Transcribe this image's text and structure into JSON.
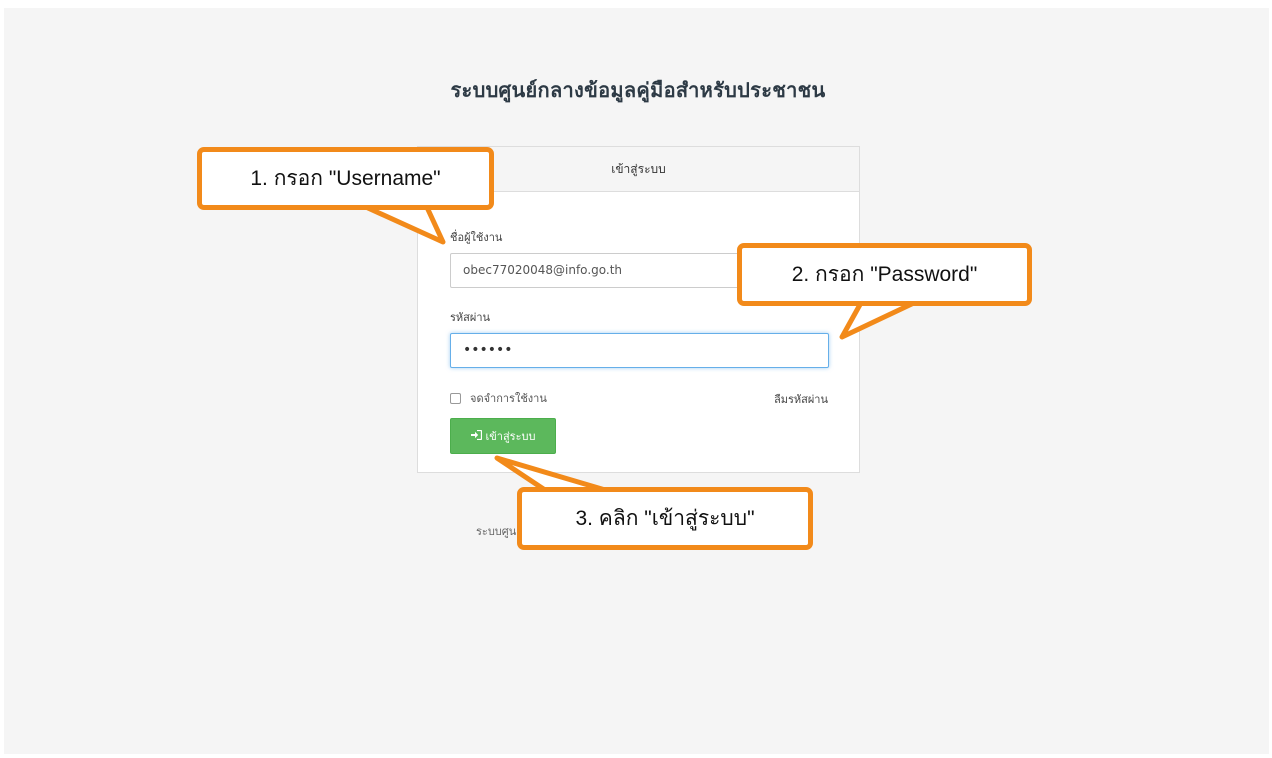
{
  "site": {
    "title": "ระบบศูนย์กลางข้อมูลคู่มือสำหรับประชาชน"
  },
  "login_panel": {
    "heading": "เข้าสู่ระบบ",
    "username_label": "ชื่อผู้ใช้งาน",
    "username_value": "obec77020048@info.go.th",
    "password_label": "รหัสผ่าน",
    "password_masked": "••••••",
    "remember_label": "จดจำการใช้งาน",
    "remember_checked": false,
    "forgot_link": "ลืมรหัสผ่าน",
    "submit_label": "เข้าสู่ระบบ",
    "submit_icon": "sign-in-icon"
  },
  "footer": {
    "text": "ระบบศูน"
  },
  "annotations": {
    "step1": "1. กรอก \"Username\"",
    "step2": "2. กรอก \"Password\"",
    "step3": "3. คลิก \"เข้าสู่ระบบ\""
  },
  "colors": {
    "callout_border": "#f28a1a",
    "button_bg": "#5cb85c",
    "focus_border": "#66afe9"
  }
}
